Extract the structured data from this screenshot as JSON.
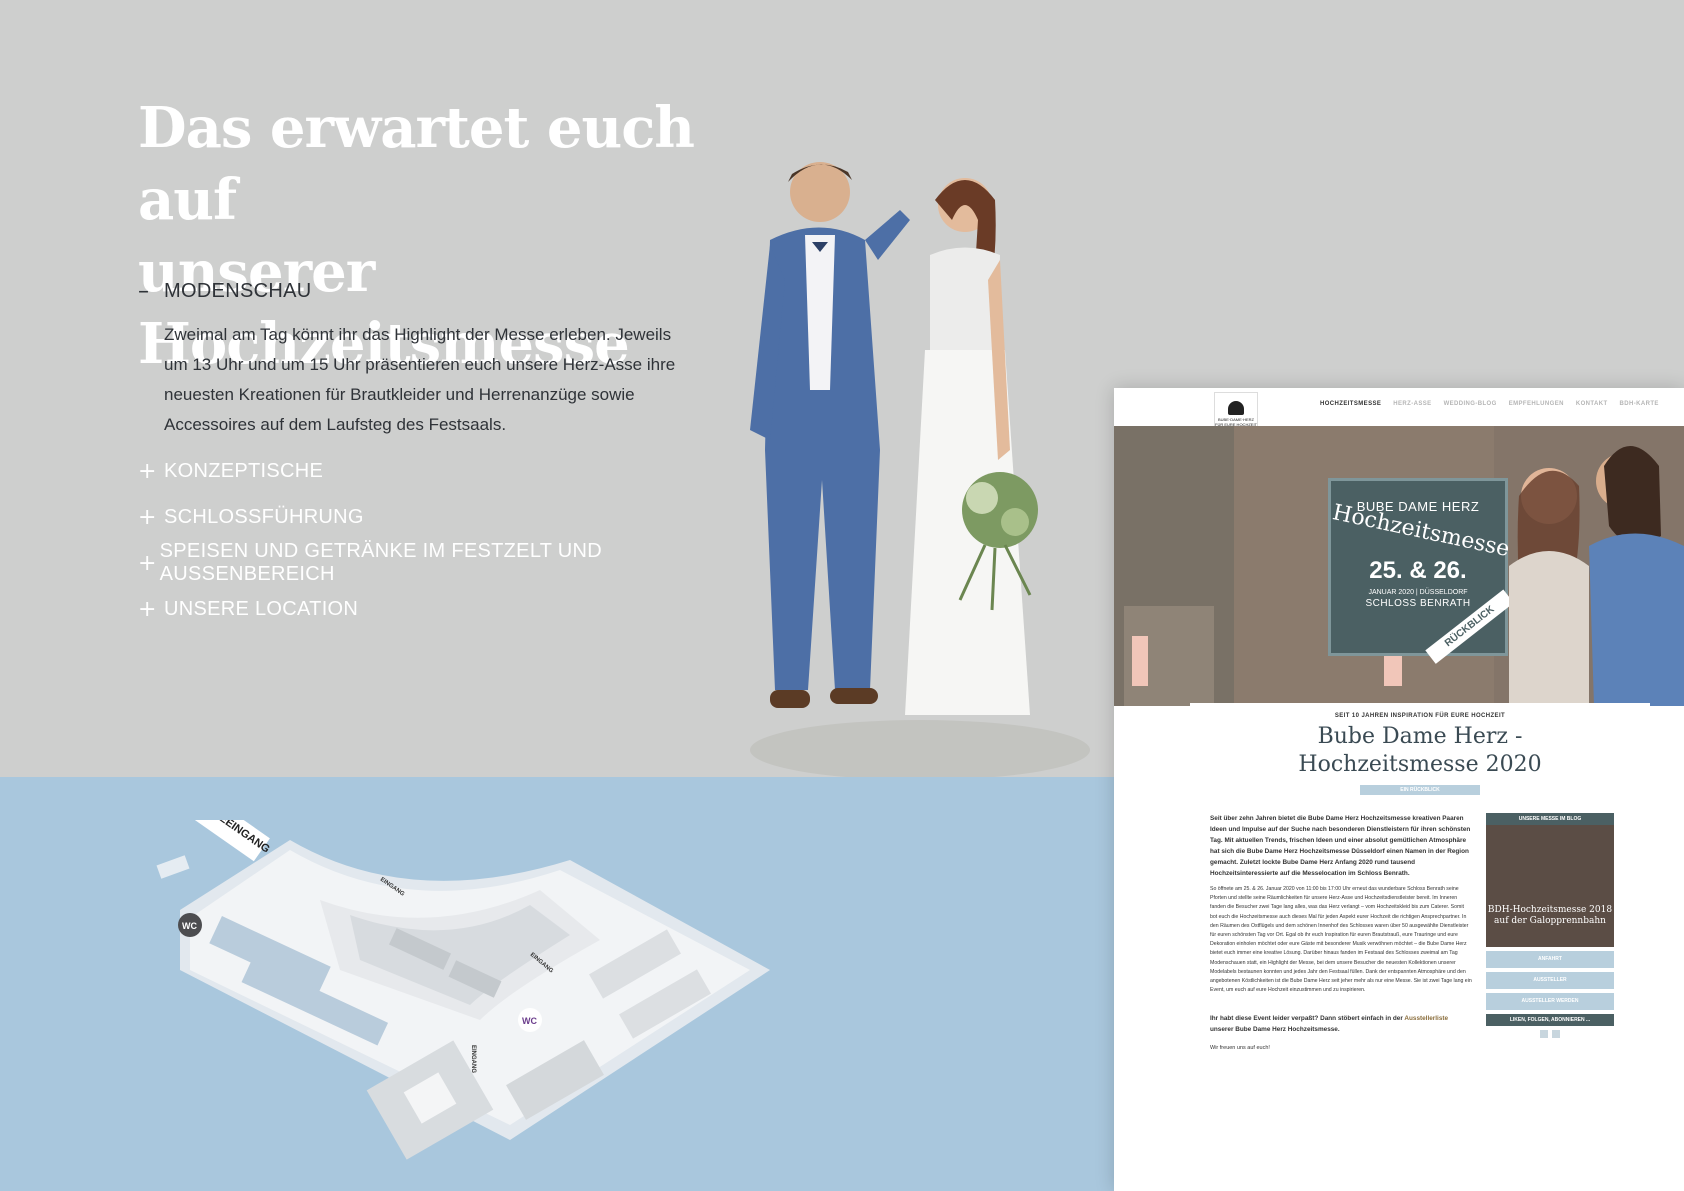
{
  "heading": {
    "line1": "Das erwartet euch auf",
    "line2": "unserer Hochzeitsmesse"
  },
  "accordion": {
    "open_symbol": "–",
    "closed_symbol": "+",
    "items": [
      {
        "label": "MODENSCHAU",
        "open": true,
        "text": "Zweimal am Tag könnt ihr das Highlight der Messe erleben. Jeweils um 13 Uhr und um 15 Uhr präsentieren euch unsere Herz-Asse ihre neuesten Kreationen für Brautkleider und Herrenanzüge sowie Accessoires auf dem Laufsteg des Festsaals."
      },
      {
        "label": "KONZEPTISCHE",
        "open": false
      },
      {
        "label": "SCHLOSSFÜHRUNG",
        "open": false
      },
      {
        "label": "SPEISEN UND GETRÄNKE IM FESTZELT UND AUSSENBEREICH",
        "open": false
      },
      {
        "label": "UNSERE LOCATION",
        "open": false
      }
    ]
  },
  "map": {
    "entrance_label": "MESSEEINGANG",
    "wc_label": "WC",
    "eingang_label": "EINGANG"
  },
  "site": {
    "logo_line1": "BUBE·DAME·HERZ",
    "logo_line2": "FÜR EURE HOCHZEIT",
    "nav": [
      "HOCHZEITSMESSE",
      "HERZ-ASSE",
      "WEDDING-BLOG",
      "EMPFEHLUNGEN",
      "KONTAKT",
      "BDH-KARTE"
    ],
    "badge": {
      "line1": "BUBE DAME HERZ",
      "line2": "Hochzeitsmesse",
      "date": "25. & 26.",
      "month": "JANUAR 2020 | DÜSSELDORF",
      "place": "SCHLOSS BENRATH",
      "ribbon": "RÜCKBLICK"
    },
    "kicker": "SEIT 10 JAHREN INSPIRATION FÜR EURE HOCHZEIT",
    "title1": "Bube Dame Herz -",
    "title2": "Hochzeitsmesse 2020",
    "pill": "EIN RÜCKBLICK",
    "lead": "Seit über zehn Jahren bietet die Bube Dame Herz Hochzeitsmesse kreativen Paaren Ideen und Impulse auf der Suche nach besonderen Dienstleistern für ihren schönsten Tag. Mit aktuellen Trends, frischen Ideen und einer absolut gemütlichen Atmosphäre hat sich die Bube Dame Herz Hochzeitsmesse Düsseldorf einen Namen in der Region gemacht. Zuletzt lockte Bube Dame Herz Anfang 2020 rund tausend Hochzeitsinteressierte auf die Messelocation im Schloss Benrath.",
    "body": "So öffnete am 25. & 26. Januar 2020 von 11:00 bis 17:00 Uhr erneut das wunderbare Schloss Benrath seine Pforten und stellte seine Räumlichkeiten für unsere Herz-Asse und Hochzeitsdienstleister bereit. Im Inneren fanden die Besucher zwei Tage lang alles, was das Herz verlangt – vom Hochzeitskleid bis zum Caterer. Somit bot euch die Hochzeitsmesse auch dieses Mal für jeden Aspekt eurer Hochzeit die richtigen Ansprechpartner. In den Räumen des Ostflügels und dem schönen Innenhof des Schlosses waren über 50 ausgewählte Dienstleister für euren schönsten Tag vor Ort. Egal ob ihr euch Inspiration für euren Brautstrauß, eure Trauringe und eure Dekoration einholen möchtet oder eure Gäste mit besonderer Musik verwöhnen möchtet – die Bube Dame Herz bietet euch immer eine kreative Lösung. Darüber hinaus fanden im Festsaal des Schlosses zweimal am Tag Modenschauen statt, ein Highlight der Messe, bei dem unsere Besucher die neuesten Kollektionen unserer Modelabels bestaunen konnten und jedes Jahr den Festsaal füllen. Dank der entspannten Atmosphäre und den angebotenen Köstlichkeiten ist die Bube Dame Herz seit jeher mehr als nur eine Messe. Sie ist zwei Tage lang ein Event, um euch auf eure Hochzeit einzustimmen und zu inspirieren.",
    "end_pre": "Ihr habt diese Event leider verpaßt? Dann stöbert einfach in der",
    "end_link": "Ausstellerliste",
    "end_post": "unserer Bube Dame Herz Hochzeitsmesse.",
    "bye": "Wir freuen uns auf euch!",
    "sidebar": {
      "head": "UNSERE MESSE IM BLOG",
      "blog_title": "BDH-Hochzeitsmesse 2018 auf der Galopprennbahn",
      "buttons": [
        "ANFAHRT",
        "AUSSTELLER",
        "AUSSTELLER WERDEN"
      ],
      "footer": "LIKEN, FOLGEN, ABONNIEREN ..."
    }
  },
  "colors": {
    "top_bg": "#cecfce",
    "bottom_bg": "#a9c7dd",
    "accent_slate": "#4b6063",
    "pill_blue": "#b8cfdd"
  }
}
